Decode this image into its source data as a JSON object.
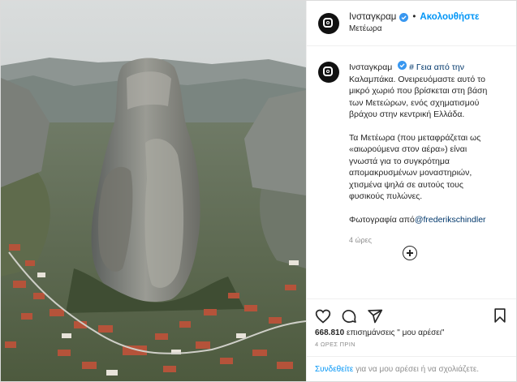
{
  "photo": {
    "alt_name": "meteora-rock-photo"
  },
  "header": {
    "username": "Ινσταγκραμ",
    "separator": "•",
    "follow_label": "Ακολουθήστε",
    "location": "Μετέωρα"
  },
  "caption": {
    "username": "Ινσταγκραμ",
    "hashtag": "# Γεια από την",
    "text1": "Καλαμπάκα. Ονειρευόμαστε αυτό το μικρό χωριό που βρίσκεται στη βάση των Μετεώρων, ενός σχηματισμού βράχου στην κεντρική Ελλάδα.",
    "text2": "Τα Μετέωρα (που μεταφράζεται ως «αιωρούμενα στον αέρα») είναι γνωστά για το συγκρότημα απομακρυσμένων μοναστηριών, χτισμένα ψηλά σε αυτούς τους φυσικούς πυλώνες.",
    "photo_credit_prefix": "Φωτογραφία από",
    "photo_credit_user": "@frederikschindler",
    "time": "4 ώρες"
  },
  "actions": {
    "likes_count": "668.810",
    "likes_suffix": "επισημάνσεις \" μου αρέσει\"",
    "ago": "4 ΩΡΕΣ ΠΡΙΝ"
  },
  "login_bar": {
    "link": "Συνδεθείτε",
    "text": "για να μου αρέσει ή να σχολιάζετε."
  },
  "colors": {
    "link": "#0095f6",
    "hashtag": "#00376b",
    "muted": "#8e8e8e"
  }
}
